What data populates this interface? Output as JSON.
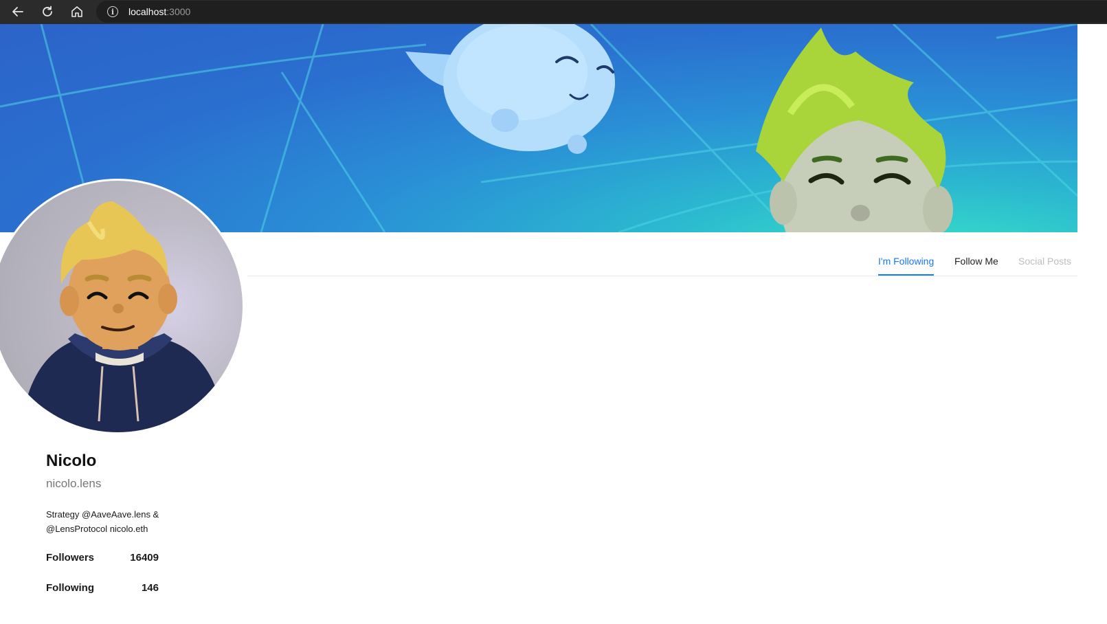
{
  "browser": {
    "url_host": "localhost",
    "url_port": ":3000",
    "info_icon_glyph": "i",
    "icons": [
      "back-arrow-icon",
      "reload-icon",
      "home-icon",
      "info-icon"
    ]
  },
  "cover": {
    "image": "cover-banner-illustration"
  },
  "avatar": {
    "image": "profile-avatar-3d-character"
  },
  "tabs": [
    {
      "label": "I'm Following",
      "active": true
    },
    {
      "label": "Follow Me",
      "active": false
    },
    {
      "label": "Social Posts",
      "active": false,
      "disabled": true
    }
  ],
  "profile": {
    "name": "Nicolo",
    "handle": "nicolo.lens",
    "bio": "Strategy @AaveAave.lens & @LensProtocol nicolo.eth",
    "stats": {
      "followers_label": "Followers",
      "followers_value": "16409",
      "following_label": "Following",
      "following_value": "146"
    }
  },
  "colors": {
    "accent": "#1677ff",
    "browser_bar": "#2b2b2b",
    "cover_blue": "#2a6fcf",
    "cover_teal": "#37e0c8"
  }
}
